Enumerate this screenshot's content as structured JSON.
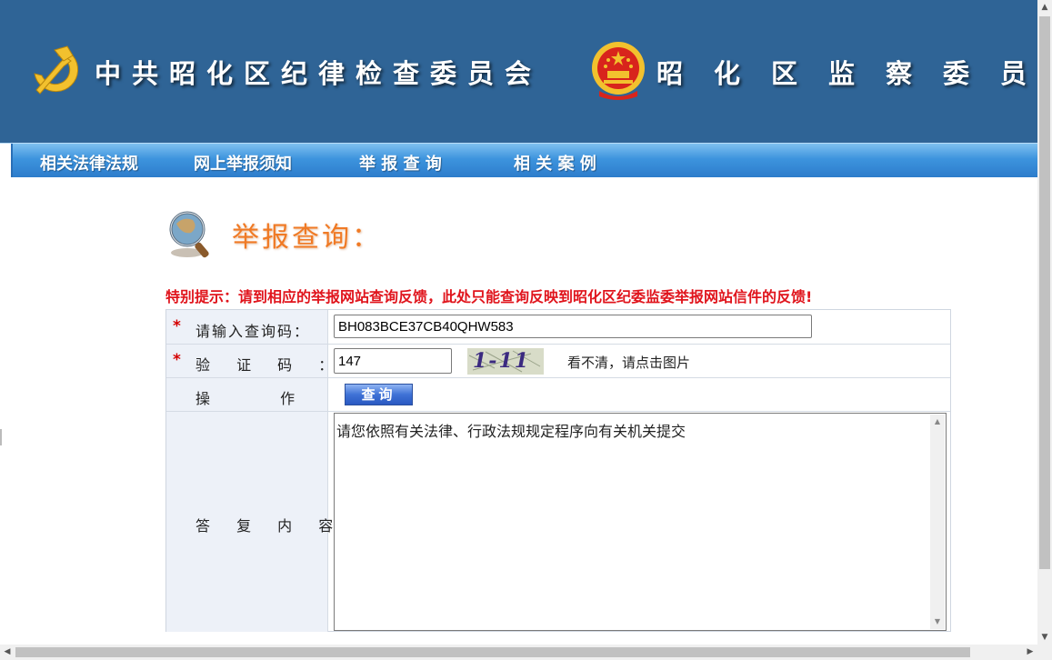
{
  "header": {
    "title_left": "中共昭化区纪律检查委员会",
    "title_right": "昭化区监察委员会",
    "emblem_left_icon": "party-emblem-icon",
    "emblem_right_icon": "national-emblem-icon",
    "banner_color": "#2f6496"
  },
  "nav": {
    "items": [
      {
        "label": "相关法律法规"
      },
      {
        "label": "网上举报须知"
      },
      {
        "label": "举 报 查 询"
      },
      {
        "label": "相 关 案 例"
      }
    ]
  },
  "page": {
    "heading_icon": "magnifier-globe-icon",
    "title": "举报查询：",
    "notice": "特别提示：请到相应的举报网站查询反馈，此处只能查询反映到昭化区纪委监委举报网站信件的反馈!",
    "notice_color": "#e0141c"
  },
  "form": {
    "required_mark": "*",
    "query_code": {
      "label": "请输入查询码：",
      "value": "BH083BCE37CB40QHW583"
    },
    "captcha": {
      "label": "验 证 码 ：",
      "value": "147",
      "image_text": "1-11",
      "hint": "看不清，请点击图片"
    },
    "action": {
      "label": "操 作 ：",
      "button_label": "查询"
    },
    "reply": {
      "label": "答 复 内 容 ：",
      "content": "请您依照有关法律、行政法规规定程序向有关机关提交"
    }
  },
  "scrollbars": {
    "up_arrow": "▲",
    "down_arrow": "▼",
    "left_arrow": "◀",
    "right_arrow": "▶"
  }
}
